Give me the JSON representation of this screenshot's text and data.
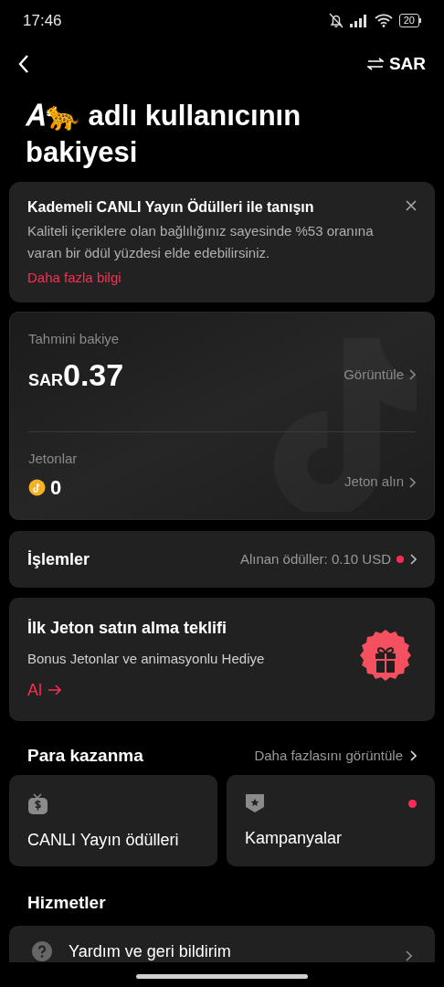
{
  "status_bar": {
    "time": "17:46",
    "battery": "20"
  },
  "header": {
    "currency": "SAR"
  },
  "title": "𝐴🐆 adlı kullanıcının bakiyesi",
  "promo_banner": {
    "title": "Kademeli CANLI Yayın Ödülleri ile tanışın",
    "text": "Kaliteli içeriklere olan bağlılığınız sayesinde %53 oranına varan bir ödül yüzdesi elde edebilirsiniz.",
    "link": "Daha fazla bilgi"
  },
  "balance": {
    "label": "Tahmini bakiye",
    "currency": "SAR",
    "amount": "0.37",
    "action": "Görüntüle",
    "coins_label": "Jetonlar",
    "coins": "0",
    "coins_action": "Jeton alın"
  },
  "transactions": {
    "label": "İşlemler",
    "detail": "Alınan ödüller: 0.10 USD",
    "unread": true
  },
  "offer": {
    "title": "İlk Jeton satın alma teklifi",
    "subtitle": "Bonus Jetonlar ve animasyonlu Hediye",
    "action": "Al"
  },
  "monetization": {
    "title": "Para kazanma",
    "more": "Daha fazlasını görüntüle",
    "cards": [
      {
        "kind": "live",
        "label": "CANLI Yayın ödülleri",
        "unread": false
      },
      {
        "kind": "campaign",
        "label": "Kampanyalar",
        "unread": true
      }
    ]
  },
  "services": {
    "title": "Hizmetler",
    "items": [
      {
        "kind": "help",
        "label": "Yardım ve geri bildirim"
      }
    ]
  }
}
